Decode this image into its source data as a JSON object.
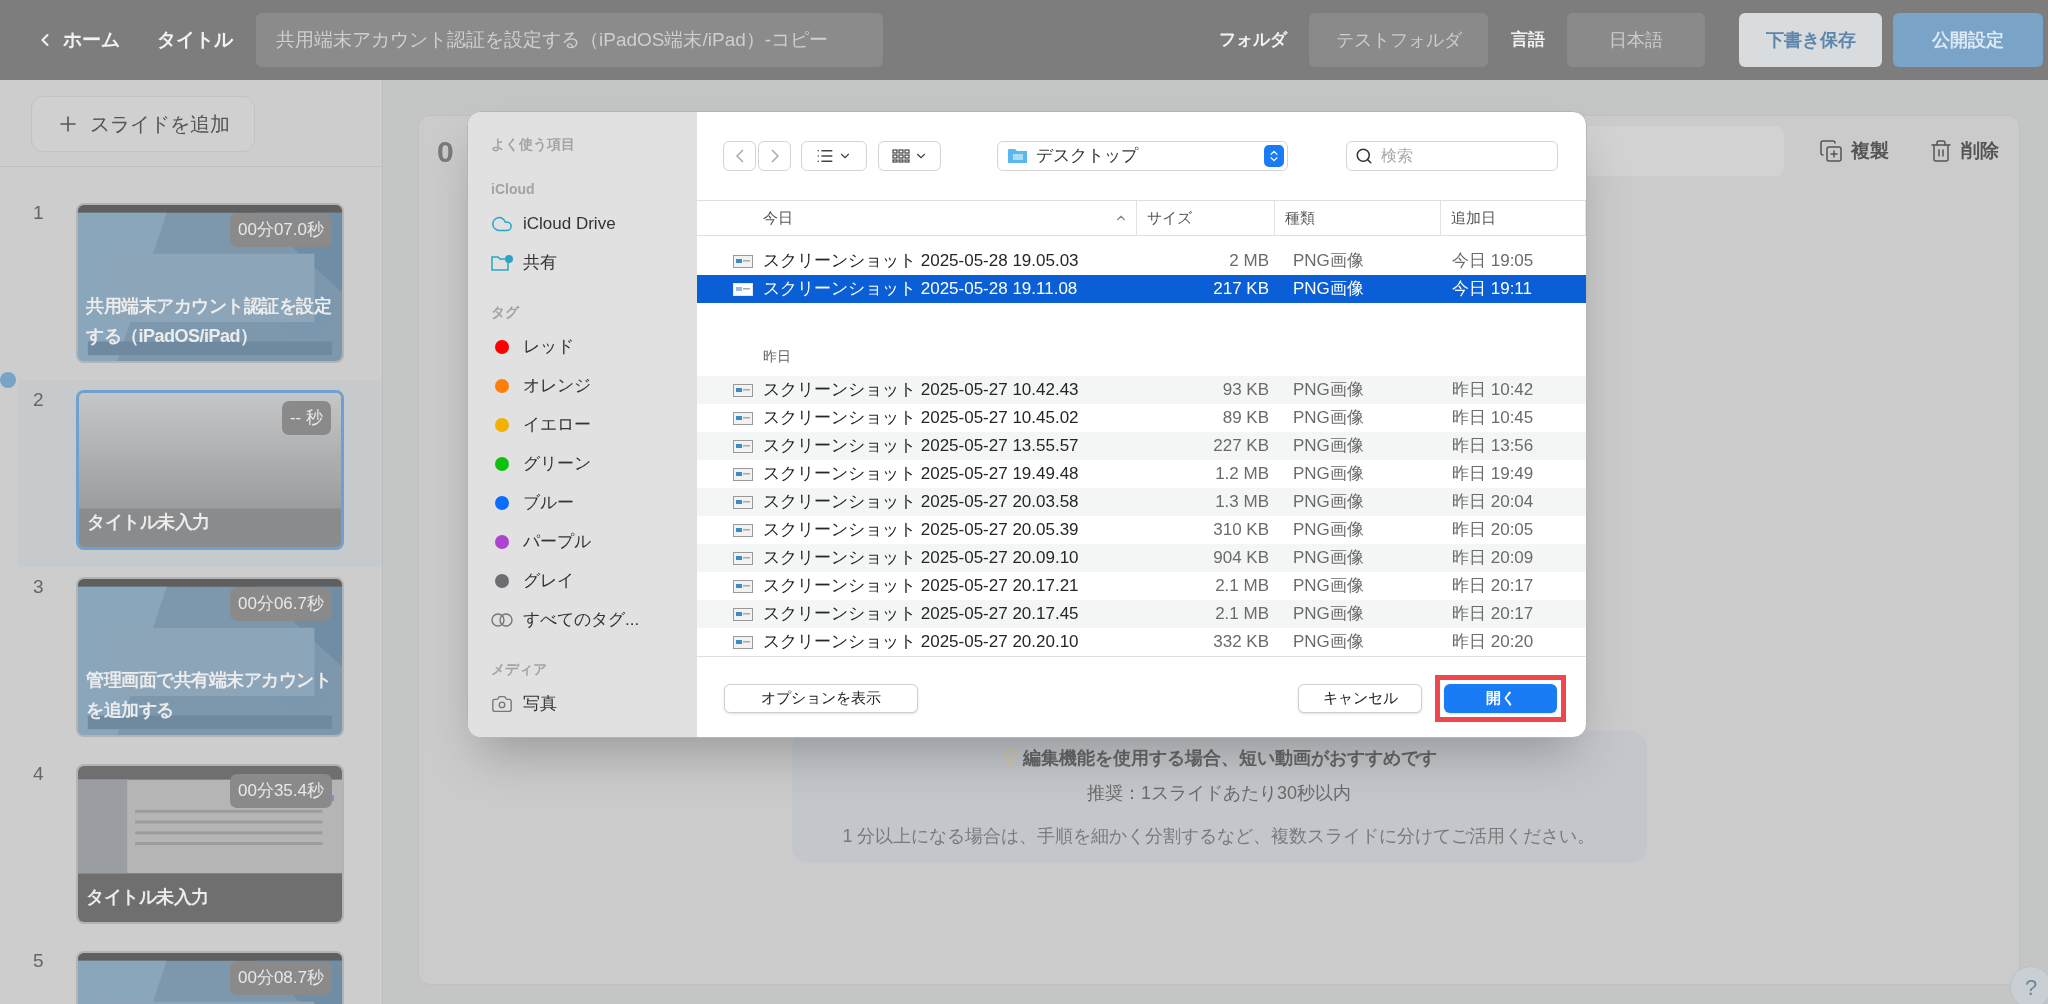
{
  "topbar": {
    "back_link": "ホーム",
    "title_label": "タイトル",
    "title_value": "共用端末アカウント認証を設定する（iPadOS端末/iPad）-コピー",
    "folder_label": "フォルダ",
    "folder_value": "テストフォルダ",
    "language_label": "言語",
    "language_value": "日本語",
    "buttons": [
      {
        "label": "下書き保存",
        "kind": "secondary"
      },
      {
        "label": "公開設定",
        "kind": "primary"
      }
    ]
  },
  "sidebar": {
    "add_button": "スライドを追加",
    "slides": [
      {
        "number": "1",
        "duration": "00分07.0秒",
        "title": "共用端末アカウント認証を設定する（iPadOS/iPad）",
        "kind": "title",
        "selected": false
      },
      {
        "number": "2",
        "duration": "-- 秒",
        "title": "タイトル未入力",
        "kind": "blank",
        "selected": true
      },
      {
        "number": "3",
        "duration": "00分06.7秒",
        "title": "管理画面で共有端末アカウントを追加する",
        "kind": "title",
        "selected": false
      },
      {
        "number": "4",
        "duration": "00分35.4秒",
        "title": "タイトル未入力",
        "kind": "screen",
        "selected": false
      },
      {
        "number": "5",
        "duration": "00分08.7秒",
        "kind": "title",
        "selected": false
      }
    ]
  },
  "editor": {
    "slide_number": "0",
    "actions": [
      {
        "label": "複製",
        "kind": "duplicate"
      },
      {
        "label": "削除",
        "kind": "delete"
      }
    ],
    "tip": {
      "heading": "編集機能を使用する場合、短い動画がおすすめです",
      "recommendation": "推奨：1スライドあたり30秒以内",
      "note": "1 分以上になる場合は、手順を細かく分割するなど、複数スライドに分けてご活用ください。"
    },
    "help_button": "?"
  },
  "dialog": {
    "sidebar": [
      {
        "heading": "よく使う項目"
      },
      {
        "heading": "iCloud",
        "items": [
          {
            "label": "iCloud Drive",
            "kind": "cloud"
          },
          {
            "label": "共有",
            "kind": "shared"
          }
        ]
      },
      {
        "heading": "タグ",
        "items": [
          {
            "label": "レッド",
            "kind": "tag",
            "color": "#fe0000"
          },
          {
            "label": "オレンジ",
            "kind": "tag",
            "color": "#fd7f08"
          },
          {
            "label": "イエロー",
            "kind": "tag",
            "color": "#f2b003"
          },
          {
            "label": "グリーン",
            "kind": "tag",
            "color": "#0fc00f"
          },
          {
            "label": "ブルー",
            "kind": "tag",
            "color": "#0a6dfd"
          },
          {
            "label": "パープル",
            "kind": "tag",
            "color": "#ad44cf"
          },
          {
            "label": "グレイ",
            "kind": "tag",
            "color": "#6e6e72"
          },
          {
            "label": "すべてのタグ...",
            "kind": "all_tags"
          }
        ]
      },
      {
        "heading": "メディア",
        "items": [
          {
            "label": "写真",
            "kind": "photos"
          }
        ]
      }
    ],
    "location": "デスクトップ",
    "search_placeholder": "検索",
    "columns": [
      {
        "label": "今日",
        "sorted": true
      },
      {
        "label": "サイズ",
        "sorted": false
      },
      {
        "label": "種類",
        "sorted": false
      },
      {
        "label": "追加日",
        "sorted": false
      }
    ],
    "groups": [
      {
        "files": [
          {
            "name": "スクリーンショット 2025-05-28 19.05.03",
            "size": "2 MB",
            "kind": "PNG画像",
            "added": "今日 19:05",
            "selected": false
          },
          {
            "name": "スクリーンショット 2025-05-28 19.11.08",
            "size": "217 KB",
            "kind": "PNG画像",
            "added": "今日 19:11",
            "selected": true
          }
        ]
      },
      {
        "label": "昨日",
        "files": [
          {
            "name": "スクリーンショット 2025-05-27 10.42.43",
            "size": "93 KB",
            "kind": "PNG画像",
            "added": "昨日 10:42",
            "selected": false
          },
          {
            "name": "スクリーンショット 2025-05-27 10.45.02",
            "size": "89 KB",
            "kind": "PNG画像",
            "added": "昨日 10:45",
            "selected": false
          },
          {
            "name": "スクリーンショット 2025-05-27 13.55.57",
            "size": "227 KB",
            "kind": "PNG画像",
            "added": "昨日 13:56",
            "selected": false
          },
          {
            "name": "スクリーンショット 2025-05-27 19.49.48",
            "size": "1.2 MB",
            "kind": "PNG画像",
            "added": "昨日 19:49",
            "selected": false
          },
          {
            "name": "スクリーンショット 2025-05-27 20.03.58",
            "size": "1.3 MB",
            "kind": "PNG画像",
            "added": "昨日 20:04",
            "selected": false
          },
          {
            "name": "スクリーンショット 2025-05-27 20.05.39",
            "size": "310 KB",
            "kind": "PNG画像",
            "added": "昨日 20:05",
            "selected": false
          },
          {
            "name": "スクリーンショット 2025-05-27 20.09.10",
            "size": "904 KB",
            "kind": "PNG画像",
            "added": "昨日 20:09",
            "selected": false
          },
          {
            "name": "スクリーンショット 2025-05-27 20.17.21",
            "size": "2.1 MB",
            "kind": "PNG画像",
            "added": "昨日 20:17",
            "selected": false
          },
          {
            "name": "スクリーンショット 2025-05-27 20.17.45",
            "size": "2.1 MB",
            "kind": "PNG画像",
            "added": "昨日 20:17",
            "selected": false
          },
          {
            "name": "スクリーンショット 2025-05-27 20.20.10",
            "size": "332 KB",
            "kind": "PNG画像",
            "added": "昨日 20:20",
            "selected": false
          }
        ]
      }
    ],
    "footer": {
      "options_button": "オプションを表示",
      "buttons": [
        {
          "label": "キャンセル",
          "kind": "cancel",
          "highlighted": false
        },
        {
          "label": "開く",
          "kind": "default",
          "highlighted": true
        }
      ]
    }
  }
}
